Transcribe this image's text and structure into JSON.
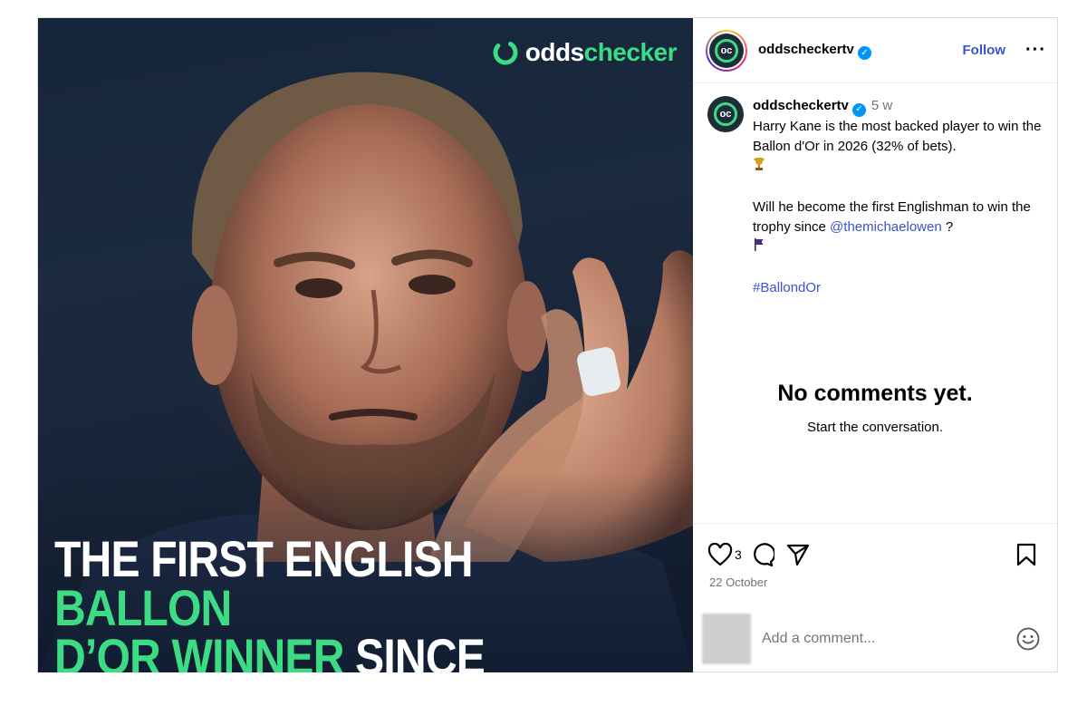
{
  "media": {
    "brand": {
      "part1": "odds",
      "part2": "checker"
    },
    "headline": {
      "line1_white": "THE FIRST ENGLISH ",
      "line1_green": "BALLON",
      "line2_green": "D’OR WINNER",
      "line2_white": " SINCE OWEN?"
    }
  },
  "header": {
    "username": "oddscheckertv",
    "follow_label": "Follow",
    "more_label": "···",
    "avatar_text": "oc"
  },
  "caption": {
    "username": "oddscheckertv",
    "time": "5 w",
    "line1": "Harry Kane is the most backed player to win the Ballon d'Or in 2026 (32% of bets).",
    "line2_prefix": "Will he become the first Englishman to win the trophy since ",
    "mention": "@themichaelowen",
    "line2_suffix": " ?",
    "hashtag": "#BallondOr"
  },
  "comments": {
    "empty_title": "No comments yet.",
    "empty_subtitle": "Start the conversation."
  },
  "actions": {
    "like_count": "3",
    "date": "22 October",
    "comment_placeholder": "Add a comment..."
  },
  "icons": [
    "heart-icon",
    "comment-icon",
    "share-icon",
    "bookmark-icon",
    "emoji-icon",
    "verified-icon",
    "trophy-icon",
    "flag-icon"
  ],
  "colors": {
    "accent_green": "#3ddc84",
    "link_blue": "#3b53c7",
    "verified_blue": "#0095f6"
  }
}
